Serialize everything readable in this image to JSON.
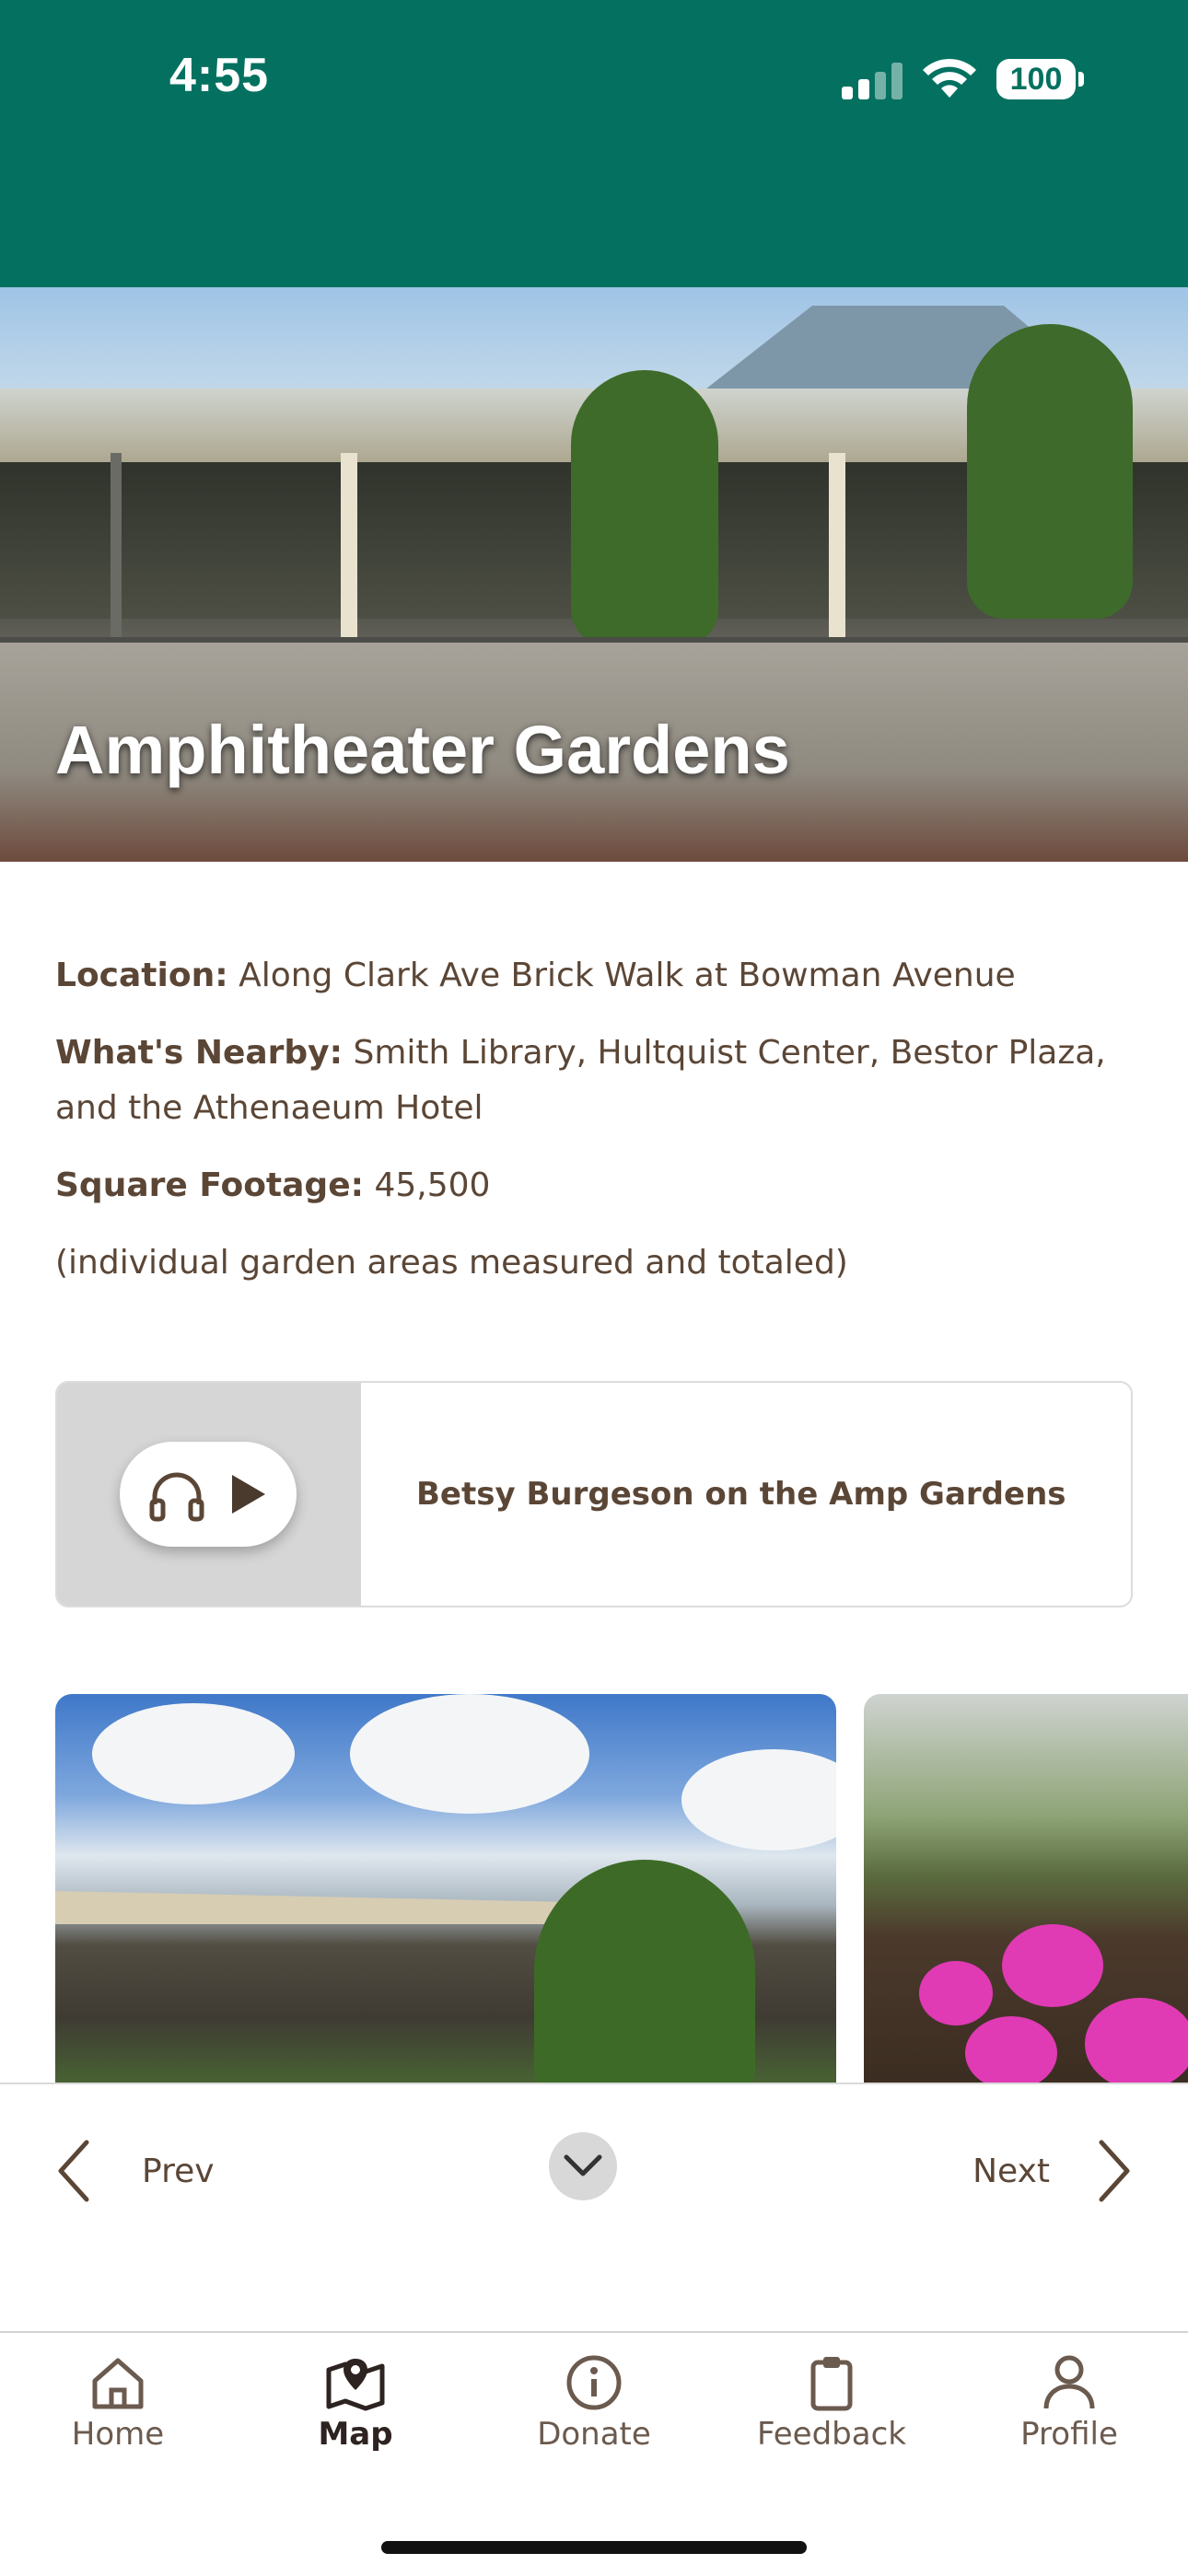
{
  "status_bar": {
    "time": "4:55",
    "battery": "100",
    "background_color": "#047160"
  },
  "hero": {
    "title": "Amphitheater Gardens"
  },
  "details": {
    "location_label": "Location:",
    "location_value": " Along Clark Ave Brick Walk at Bowman Avenue",
    "nearby_label": "What's Nearby:",
    "nearby_value": " Smith Library, Hultquist Center, Bestor Plaza, and the Athenaeum Hotel",
    "footage_label": "Square Footage:",
    "footage_value": " 45,500",
    "footage_note": "(individual garden areas measured and totaled)"
  },
  "audio": {
    "title": "Betsy Burgeson on the Amp Gardens",
    "icons": [
      "headphones-icon",
      "play-icon"
    ]
  },
  "pager": {
    "prev_label": "Prev",
    "next_label": "Next"
  },
  "tabs": [
    {
      "label": "Home",
      "icon": "home-icon",
      "active": false
    },
    {
      "label": "Map",
      "icon": "map-icon",
      "active": true
    },
    {
      "label": "Donate",
      "icon": "info-icon",
      "active": false
    },
    {
      "label": "Feedback",
      "icon": "clipboard-icon",
      "active": false
    },
    {
      "label": "Profile",
      "icon": "person-icon",
      "active": false
    }
  ],
  "colors": {
    "brand_green": "#047160",
    "text_brown": "#5b4636"
  }
}
